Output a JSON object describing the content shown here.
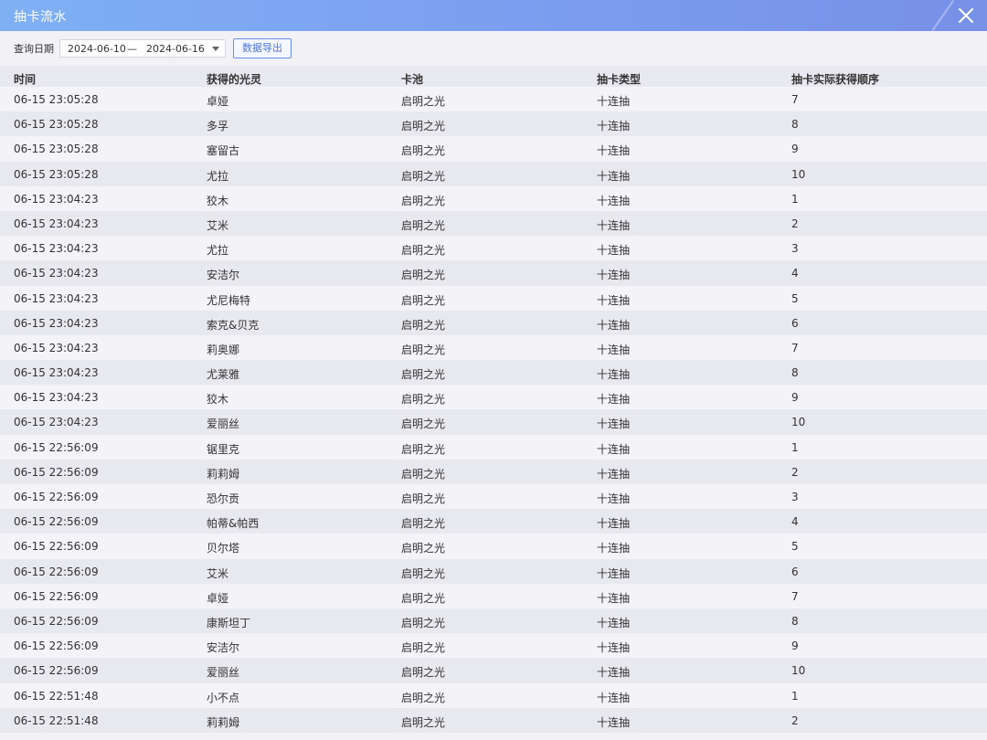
{
  "window": {
    "title": "抽卡流水",
    "colors": {
      "titlebar_start": "#7fb0f4",
      "titlebar_end": "#7790e8",
      "accent": "#4f76dc"
    }
  },
  "toolbar": {
    "date_label": "查询日期",
    "date_start": "2024-06-10",
    "date_separator": "—",
    "date_end": "2024-06-16",
    "export_label": "数据导出"
  },
  "table": {
    "headers": [
      "时间",
      "获得的光灵",
      "卡池",
      "抽卡类型",
      "抽卡实际获得顺序"
    ],
    "rows": [
      [
        "06-15 23:05:28",
        "卓娅",
        "启明之光",
        "十连抽",
        "7"
      ],
      [
        "06-15 23:05:28",
        "多孚",
        "启明之光",
        "十连抽",
        "8"
      ],
      [
        "06-15 23:05:28",
        "塞留古",
        "启明之光",
        "十连抽",
        "9"
      ],
      [
        "06-15 23:05:28",
        "尤拉",
        "启明之光",
        "十连抽",
        "10"
      ],
      [
        "06-15 23:04:23",
        "狡木",
        "启明之光",
        "十连抽",
        "1"
      ],
      [
        "06-15 23:04:23",
        "艾米",
        "启明之光",
        "十连抽",
        "2"
      ],
      [
        "06-15 23:04:23",
        "尤拉",
        "启明之光",
        "十连抽",
        "3"
      ],
      [
        "06-15 23:04:23",
        "安洁尔",
        "启明之光",
        "十连抽",
        "4"
      ],
      [
        "06-15 23:04:23",
        "尤尼梅特",
        "启明之光",
        "十连抽",
        "5"
      ],
      [
        "06-15 23:04:23",
        "索克&贝克",
        "启明之光",
        "十连抽",
        "6"
      ],
      [
        "06-15 23:04:23",
        "莉奥娜",
        "启明之光",
        "十连抽",
        "7"
      ],
      [
        "06-15 23:04:23",
        "尤莱雅",
        "启明之光",
        "十连抽",
        "8"
      ],
      [
        "06-15 23:04:23",
        "狡木",
        "启明之光",
        "十连抽",
        "9"
      ],
      [
        "06-15 23:04:23",
        "爱丽丝",
        "启明之光",
        "十连抽",
        "10"
      ],
      [
        "06-15 22:56:09",
        "锯里克",
        "启明之光",
        "十连抽",
        "1"
      ],
      [
        "06-15 22:56:09",
        "莉莉姆",
        "启明之光",
        "十连抽",
        "2"
      ],
      [
        "06-15 22:56:09",
        "恐尔贡",
        "启明之光",
        "十连抽",
        "3"
      ],
      [
        "06-15 22:56:09",
        "帕蒂&帕西",
        "启明之光",
        "十连抽",
        "4"
      ],
      [
        "06-15 22:56:09",
        "贝尔塔",
        "启明之光",
        "十连抽",
        "5"
      ],
      [
        "06-15 22:56:09",
        "艾米",
        "启明之光",
        "十连抽",
        "6"
      ],
      [
        "06-15 22:56:09",
        "卓娅",
        "启明之光",
        "十连抽",
        "7"
      ],
      [
        "06-15 22:56:09",
        "康斯坦丁",
        "启明之光",
        "十连抽",
        "8"
      ],
      [
        "06-15 22:56:09",
        "安洁尔",
        "启明之光",
        "十连抽",
        "9"
      ],
      [
        "06-15 22:56:09",
        "爱丽丝",
        "启明之光",
        "十连抽",
        "10"
      ],
      [
        "06-15 22:51:48",
        "小不点",
        "启明之光",
        "十连抽",
        "1"
      ],
      [
        "06-15 22:51:48",
        "莉莉姆",
        "启明之光",
        "十连抽",
        "2"
      ]
    ]
  }
}
